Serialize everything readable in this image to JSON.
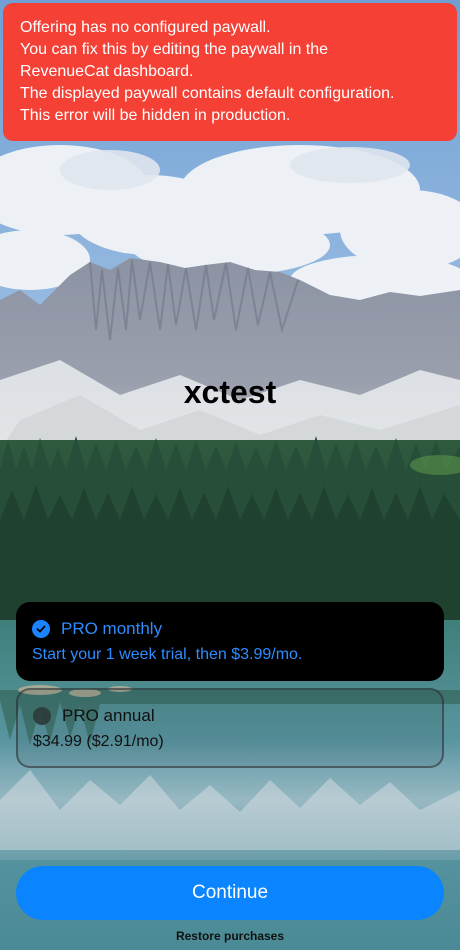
{
  "error_banner": {
    "lines": [
      "Offering has no configured paywall.",
      "You can fix this by editing the paywall in the",
      "RevenueCat dashboard.",
      "The displayed paywall contains default configuration.",
      "This error will be hidden in production."
    ],
    "color": "#f44035"
  },
  "paywall": {
    "title": "xctest",
    "background_image": "mountain-lake-landscape"
  },
  "packages": [
    {
      "name": "PRO monthly",
      "detail": "Start your 1 week trial, then $3.99/mo.",
      "selected": true,
      "icon": "checkmark-circle-icon"
    },
    {
      "name": "PRO annual",
      "detail": "$34.99 ($2.91/mo)",
      "selected": false,
      "icon": "empty-circle-icon"
    }
  ],
  "actions": {
    "continue_label": "Continue",
    "restore_label": "Restore purchases"
  },
  "colors": {
    "accent": "#0a84ff",
    "selected_package_bg": "#000000",
    "error": "#f44035"
  }
}
